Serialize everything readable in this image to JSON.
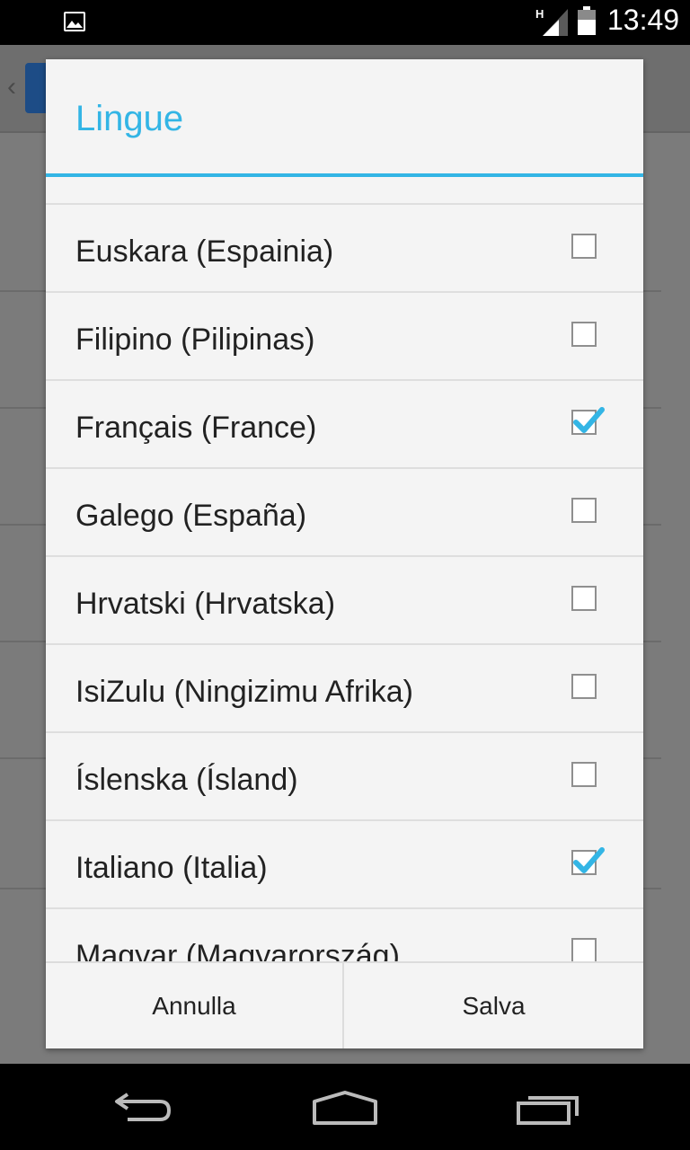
{
  "status_bar": {
    "network_type": "H",
    "time": "13:49",
    "icons": [
      "image-notification-icon",
      "signal-icon",
      "battery-icon"
    ]
  },
  "dialog": {
    "title": "Lingue",
    "languages": [
      {
        "label": "",
        "checked": false
      },
      {
        "label": "Euskara (Espainia)",
        "checked": false
      },
      {
        "label": "Filipino (Pilipinas)",
        "checked": false
      },
      {
        "label": "Français (France)",
        "checked": true
      },
      {
        "label": "Galego (España)",
        "checked": false
      },
      {
        "label": "Hrvatski (Hrvatska)",
        "checked": false
      },
      {
        "label": "IsiZulu (Ningizimu Afrika)",
        "checked": false
      },
      {
        "label": "Íslenska (Ísland)",
        "checked": false
      },
      {
        "label": "Italiano (Italia)",
        "checked": true
      },
      {
        "label": "Magyar (Magyarország)",
        "checked": false
      }
    ],
    "buttons": {
      "cancel": "Annulla",
      "save": "Salva"
    }
  },
  "nav_bar": {
    "icons": [
      "back-icon",
      "home-icon",
      "recent-apps-icon"
    ]
  },
  "colors": {
    "accent": "#33b5e5",
    "dialog_bg": "#f4f4f4",
    "dim_bg": "#7b7b7b"
  }
}
